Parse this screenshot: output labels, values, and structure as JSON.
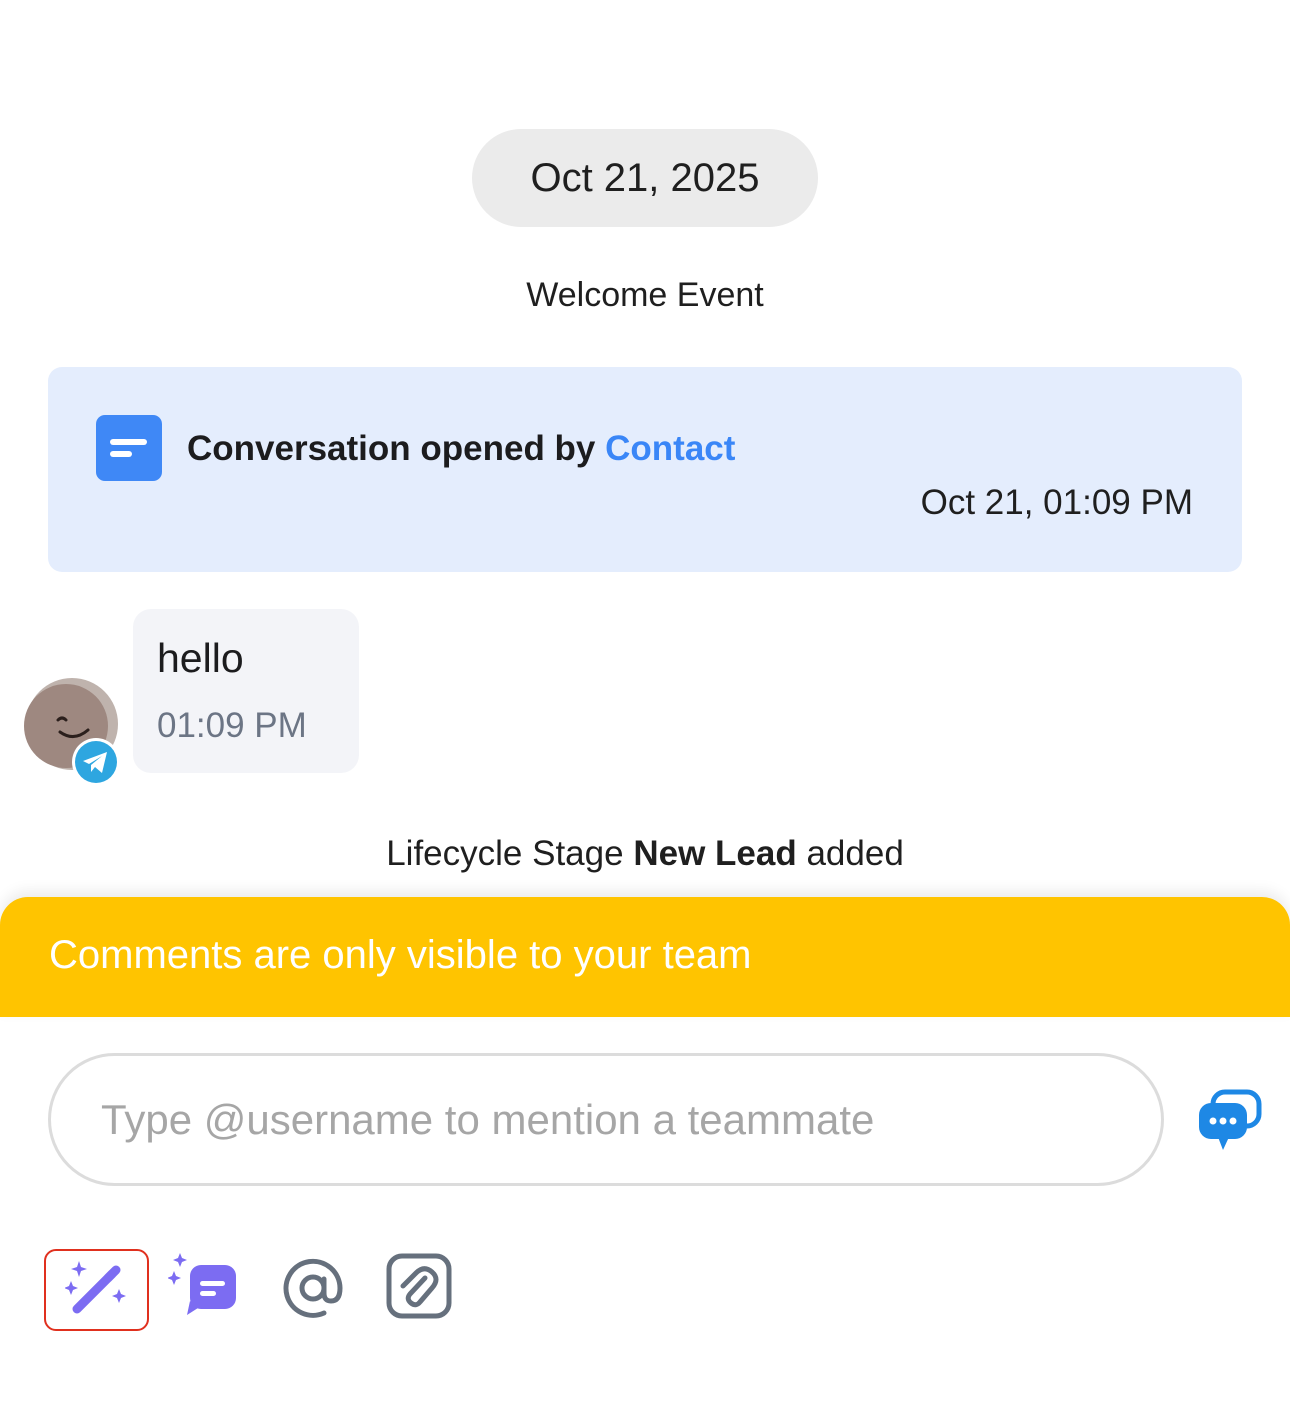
{
  "timeline": {
    "date_divider": "Oct 21, 2025",
    "welcome_event": "Welcome Event",
    "conversation_event": {
      "prefix": "Conversation opened by",
      "actor": "Contact",
      "timestamp": "Oct 21, 01:09 PM"
    },
    "message": {
      "text": "hello",
      "time": "01:09 PM",
      "channel_icon": "telegram-icon"
    },
    "lifecycle_event": {
      "prefix": "Lifecycle Stage",
      "stage": "New Lead",
      "suffix": "added"
    }
  },
  "composer": {
    "banner_text": "Comments are only visible to your team",
    "input_placeholder": "Type @username to mention a teammate",
    "input_value": "",
    "toolbar": [
      "ai-magic-wand-icon",
      "ai-summary-icon",
      "mention-at-icon",
      "attachment-icon"
    ]
  },
  "colors": {
    "accent_blue": "#3a86f7",
    "event_card_bg": "#e4edfd",
    "banner_yellow": "#ffc400",
    "ai_purple": "#7c6cf2",
    "active_tool_border": "#e0301e"
  }
}
